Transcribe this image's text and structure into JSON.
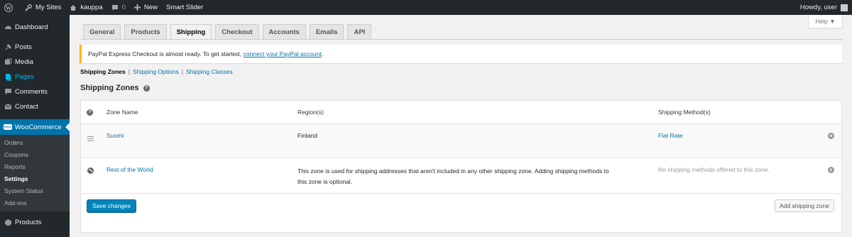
{
  "adminbar": {
    "my_sites": "My Sites",
    "site_name": "kauppa",
    "comments_count": "0",
    "new_label": "New",
    "smart_slider": "Smart Slider",
    "howdy": "Howdy, user"
  },
  "sidebar": {
    "dashboard": "Dashboard",
    "posts": "Posts",
    "media": "Media",
    "pages": "Pages",
    "comments": "Comments",
    "contact": "Contact",
    "woocommerce": "WooCommerce",
    "woo_badge": "WOO",
    "submenu": [
      "Orders",
      "Coupons",
      "Reports",
      "Settings",
      "System Status",
      "Add-ons"
    ],
    "products": "Products"
  },
  "help": "Help ▼",
  "tabs": [
    "General",
    "Products",
    "Shipping",
    "Checkout",
    "Accounts",
    "Emails",
    "API"
  ],
  "notice": {
    "text": "PayPal Express Checkout is almost ready. To get started,",
    "link": "connect your PayPal account",
    "end": "."
  },
  "subsub": {
    "zones": "Shipping Zones",
    "options": "Shipping Options",
    "classes": "Shipping Classes",
    "sep": "|"
  },
  "section_title": "Shipping Zones",
  "table": {
    "headers": {
      "name": "Zone Name",
      "regions": "Region(s)",
      "methods": "Shipping Method(s)"
    },
    "rows": [
      {
        "name": "Suomi",
        "region": "Finland",
        "method": "Flat Rate"
      },
      {
        "name": "Rest of the World",
        "region_line1": "This zone is used for shipping addresses that aren't included in any other shipping zone. Adding shipping methods to",
        "region_line2": "this zone is optional.",
        "method": "No shipping methods offered to this zone."
      }
    ]
  },
  "buttons": {
    "save": "Save changes",
    "add_zone": "Add shipping zone"
  },
  "colors": {
    "accent": "#0073aa",
    "adminbar": "#23282d",
    "notice_border": "#ffb900",
    "primary_button": "#0085ba"
  }
}
